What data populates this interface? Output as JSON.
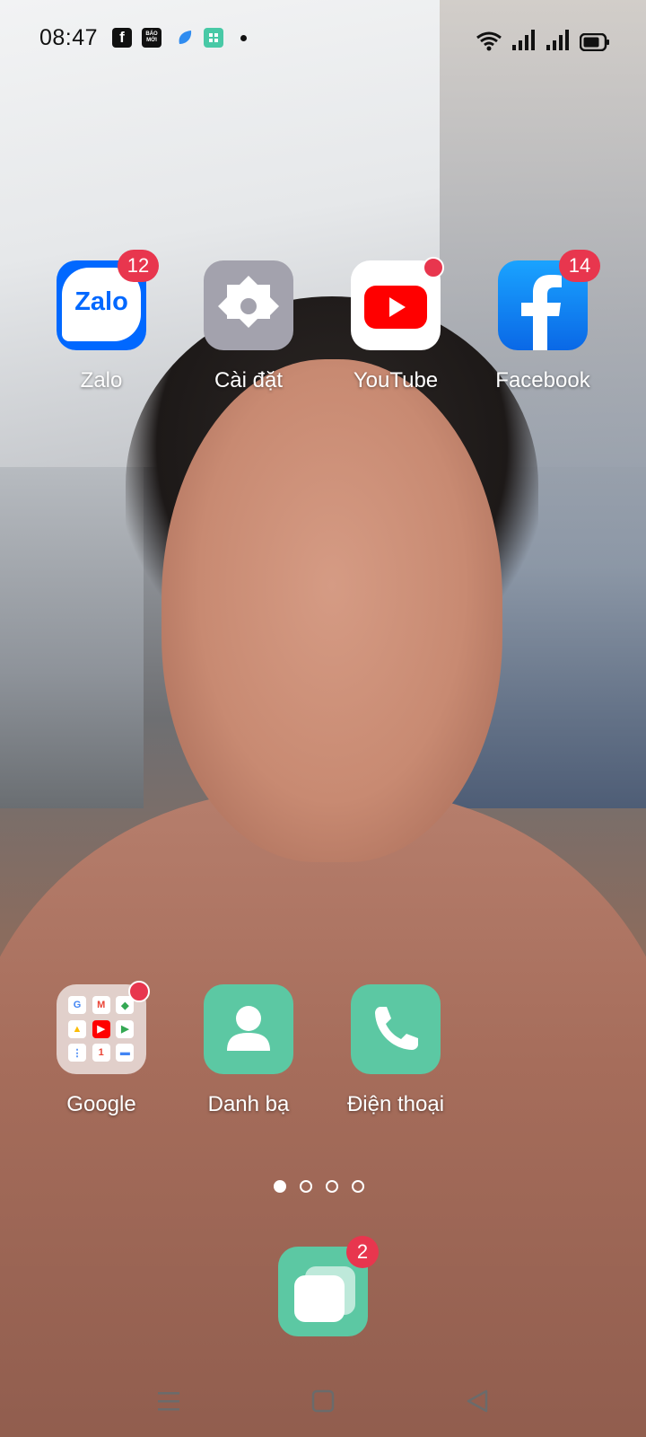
{
  "status_bar": {
    "time": "08:47",
    "notification_icons": [
      "facebook-icon",
      "baomoi-icon",
      "blue-app-icon",
      "green-app-icon",
      "more-notifications-dot"
    ],
    "notif_baomoi_text": "BÁO MỚI",
    "system_icons": [
      "wifi-icon",
      "signal-icon-sim1",
      "signal-icon-sim2",
      "battery-icon"
    ]
  },
  "apps_row1": [
    {
      "label": "Zalo",
      "badge": "12",
      "icon": "zalo-icon",
      "icon_text": "Zalo"
    },
    {
      "label": "Cài đặt",
      "badge": "",
      "icon": "settings-icon"
    },
    {
      "label": "YouTube",
      "badge": "dot",
      "icon": "youtube-icon"
    },
    {
      "label": "Facebook",
      "badge": "14",
      "icon": "facebook-icon"
    }
  ],
  "apps_row2": [
    {
      "label": "Google",
      "badge": "dot",
      "icon": "google-folder-icon"
    },
    {
      "label": "Danh bạ",
      "badge": "",
      "icon": "contacts-icon"
    },
    {
      "label": "Điện thoại",
      "badge": "",
      "icon": "phone-icon"
    }
  ],
  "page_indicator": {
    "pages": 4,
    "active": 1
  },
  "dock": {
    "badge": "2",
    "icon": "multitask-app-icon"
  },
  "navbar": {
    "buttons": [
      "recents-icon",
      "home-icon",
      "back-icon"
    ]
  },
  "colors": {
    "badge_red": "#e8364e",
    "teal": "#5cc8a3",
    "facebook_blue": "#0a68e6",
    "zalo_blue": "#0068ff"
  }
}
